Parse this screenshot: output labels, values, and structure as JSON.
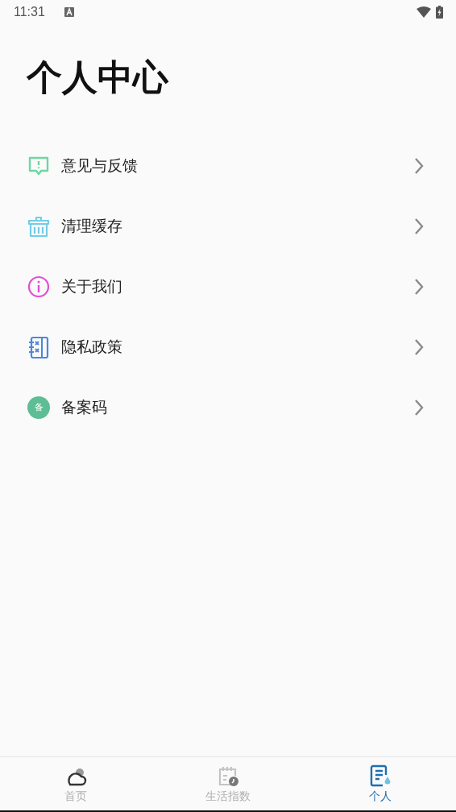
{
  "status_bar": {
    "time": "11:31"
  },
  "title": "个人中心",
  "menu": [
    {
      "kind": "feedback",
      "label": "意见与反馈"
    },
    {
      "kind": "clean",
      "label": "清理缓存"
    },
    {
      "kind": "about",
      "label": "关于我们"
    },
    {
      "kind": "privacy",
      "label": "隐私政策"
    },
    {
      "kind": "record",
      "label": "备案码",
      "badge": "备"
    }
  ],
  "tabs": [
    {
      "kind": "home",
      "label": "首页",
      "selected": false
    },
    {
      "kind": "life",
      "label": "生活指数",
      "selected": false
    },
    {
      "kind": "me",
      "label": "个人",
      "selected": true
    }
  ]
}
